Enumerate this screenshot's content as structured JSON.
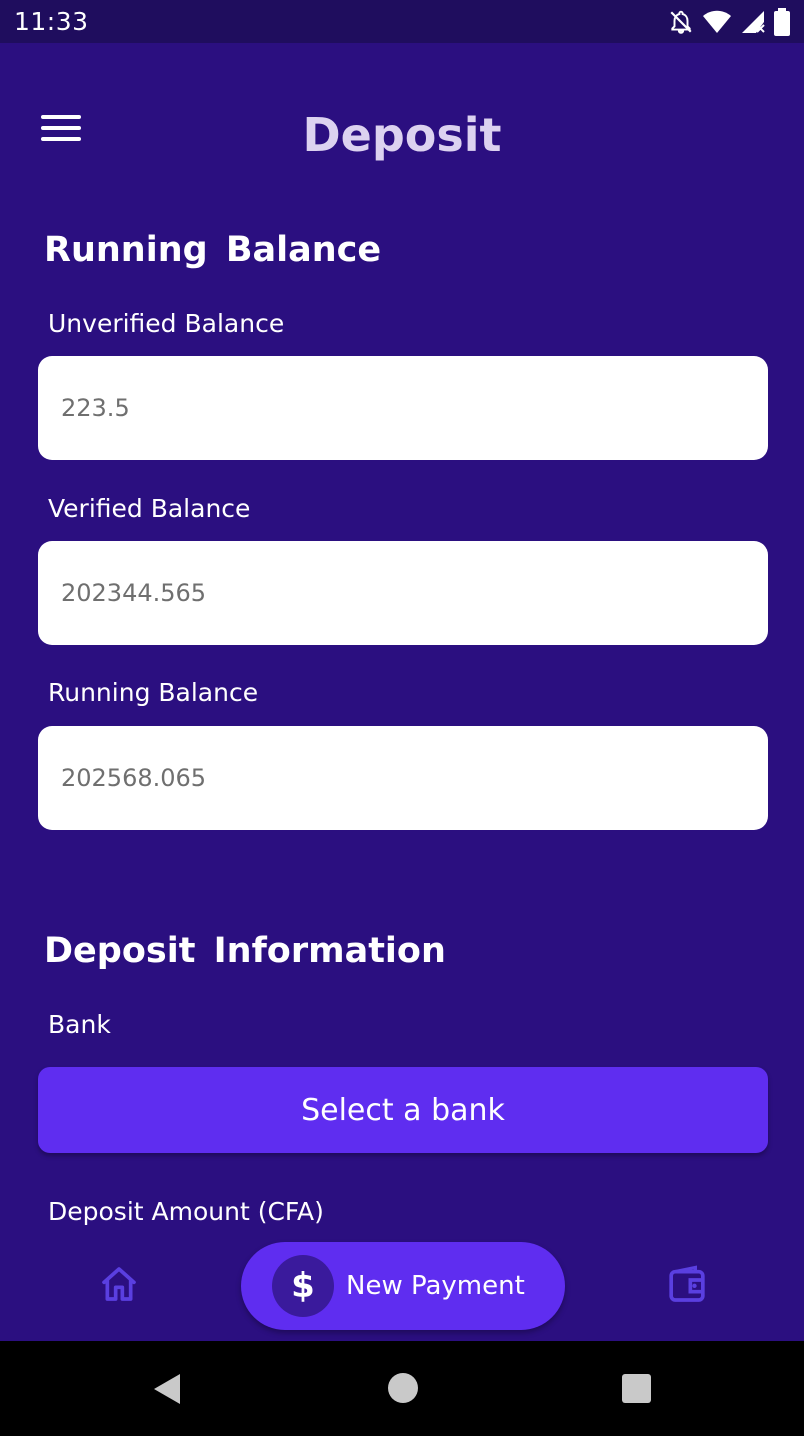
{
  "status_bar": {
    "time": "11:33"
  },
  "header": {
    "title": "Deposit",
    "menu_icon": "hamburger-menu-icon"
  },
  "running_balance_section": {
    "title": "Running  Balance",
    "fields": [
      {
        "label": "Unverified Balance",
        "value": "223.5"
      },
      {
        "label": "Verified Balance",
        "value": "202344.565"
      },
      {
        "label": "Running Balance",
        "value": "202568.065"
      }
    ]
  },
  "deposit_section": {
    "title": "Deposit  Information",
    "bank_label": "Bank",
    "bank_button": "Select a bank",
    "amount_label": "Deposit Amount (CFA)"
  },
  "bottom_nav": {
    "home_icon": "home-icon",
    "new_payment_icon": "dollar-icon",
    "new_payment_symbol": "$",
    "new_payment_label": "New Payment",
    "wallet_icon": "wallet-icon"
  },
  "colors": {
    "background": "#2b0f80",
    "status_bar": "#1f0d5e",
    "accent": "#5f2df0",
    "title_text": "#dcd2f0",
    "nav_icon": "#5a3fe0"
  }
}
